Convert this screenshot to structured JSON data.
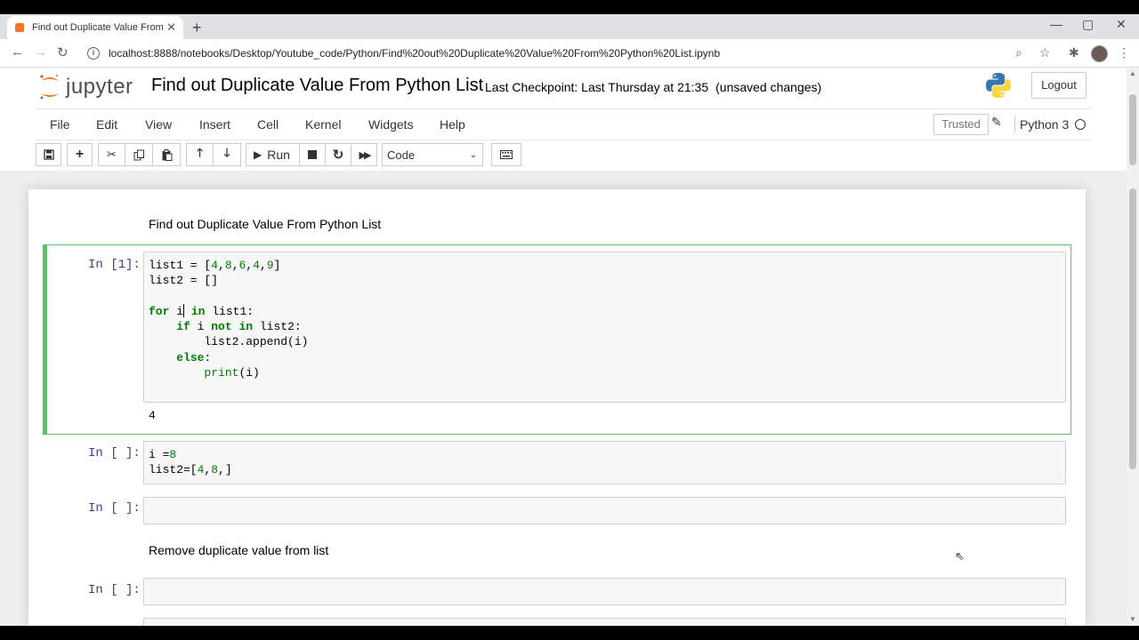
{
  "browser": {
    "tab_title": "Find out Duplicate Value From Py",
    "url": "localhost:8888/notebooks/Desktop/Youtube_code/Python/Find%20out%20Duplicate%20Value%20From%20Python%20List.ipynb"
  },
  "header": {
    "logo_text": "jupyter",
    "notebook_name": "Find out Duplicate Value From Python List",
    "checkpoint": "Last Checkpoint: Last Thursday at 21:35",
    "unsaved": "(unsaved changes)",
    "logout_label": "Logout"
  },
  "menubar": {
    "items": [
      "File",
      "Edit",
      "View",
      "Insert",
      "Cell",
      "Kernel",
      "Widgets",
      "Help"
    ],
    "trusted_label": "Trusted",
    "kernel_name": "Python 3"
  },
  "toolbar": {
    "run_label": "Run",
    "cell_type": "Code"
  },
  "cells": [
    {
      "type": "markdown",
      "text": "Find out Duplicate Value From Python List"
    },
    {
      "type": "code",
      "prompt": "In [1]:",
      "output": "4"
    },
    {
      "type": "code",
      "prompt": "In [ ]:"
    },
    {
      "type": "code",
      "prompt": "In [ ]:"
    },
    {
      "type": "markdown",
      "text": "Remove duplicate value from list"
    },
    {
      "type": "code",
      "prompt": "In [ ]:"
    }
  ],
  "colors": {
    "selected_cell_border": "#66bb6a",
    "prompt": "#303f9f",
    "keyword": "#008000"
  }
}
